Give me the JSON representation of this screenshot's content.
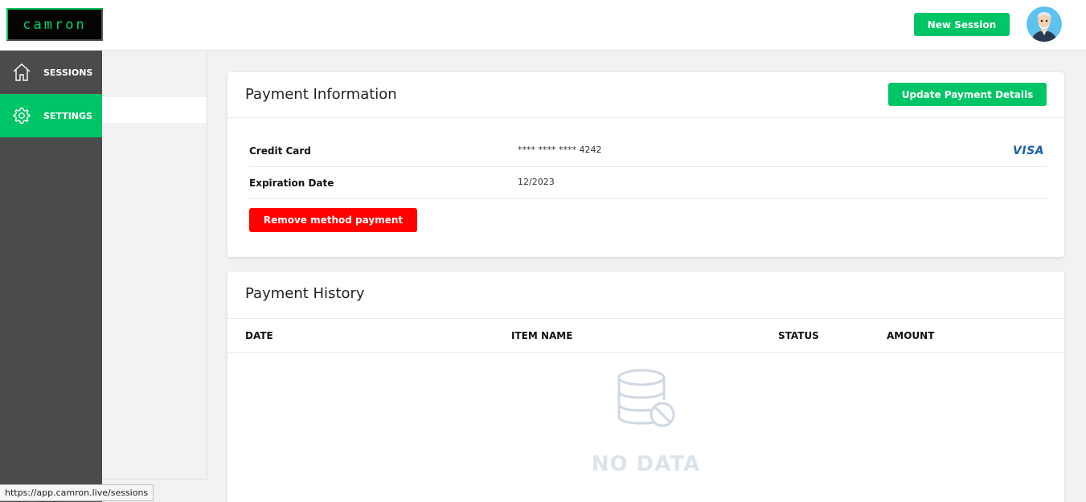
{
  "app": {
    "logo_text": "camron",
    "accent": "#00c566",
    "danger": "#ff0000"
  },
  "header": {
    "new_session_label": "New Session",
    "avatar_icon": "user-avatar-icon"
  },
  "sidebar": {
    "items": [
      {
        "label": "SESSIONS",
        "icon": "home-icon",
        "active": false
      },
      {
        "label": "SETTINGS",
        "icon": "gear-icon",
        "active": true
      }
    ]
  },
  "payment_info": {
    "title": "Payment Information",
    "update_label": "Update Payment Details",
    "rows": [
      {
        "label": "Credit Card",
        "value": "**** **** **** 4242",
        "brand": "VISA"
      },
      {
        "label": "Expiration Date",
        "value": "12/2023"
      }
    ],
    "remove_label": "Remove method payment"
  },
  "payment_history": {
    "title": "Payment History",
    "columns": [
      "DATE",
      "ITEM NAME",
      "STATUS",
      "AMOUNT"
    ],
    "empty_text": "NO DATA",
    "empty_icon": "database-off-icon"
  },
  "status_bar": {
    "url": "https://app.camron.live/sessions"
  }
}
